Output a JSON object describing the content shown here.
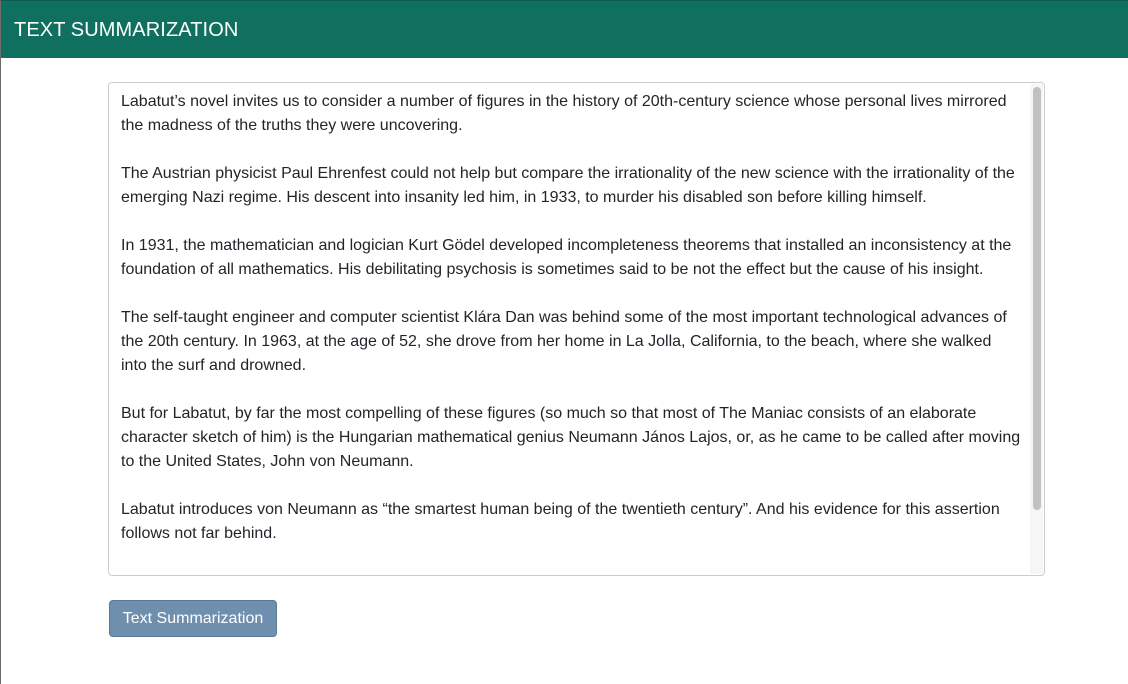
{
  "header": {
    "title": "TEXT SUMMARIZATION",
    "background_color": "#10705f"
  },
  "editor": {
    "paragraphs": [
      "Labatut’s novel invites us to consider a number of figures in the history of 20th-century science whose personal lives mirrored the madness of the truths they were uncovering.",
      "The Austrian physicist Paul Ehrenfest could not help but compare the irrationality of the new science with the irrationality of the emerging Nazi regime. His descent into insanity led him, in 1933, to murder his disabled son before killing himself.",
      "In 1931, the mathematician and logician Kurt Gödel developed incompleteness theorems that installed an inconsistency at the foundation of all mathematics. His debilitating psychosis is sometimes said to be not the effect but the cause of his insight.",
      "The self-taught engineer and computer scientist Klára Dan was behind some of the most important technological advances of the 20th century. In 1963, at the age of 52, she drove from her home in La Jolla, California, to the beach, where she walked into the surf and drowned.",
      "But for Labatut, by far the most compelling of these figures (so much so that most of The Maniac consists of an elaborate character sketch of him) is the Hungarian mathematical genius Neumann János Lajos, or, as he came to be called after moving to the United States, John von Neumann.",
      "Labatut introduces von Neumann as “the smartest human being of the twentieth century”. And his evidence for this assertion follows not far behind."
    ]
  },
  "actions": {
    "summarize_label": "Text Summarization",
    "summarize_color": "#6f8fae"
  }
}
